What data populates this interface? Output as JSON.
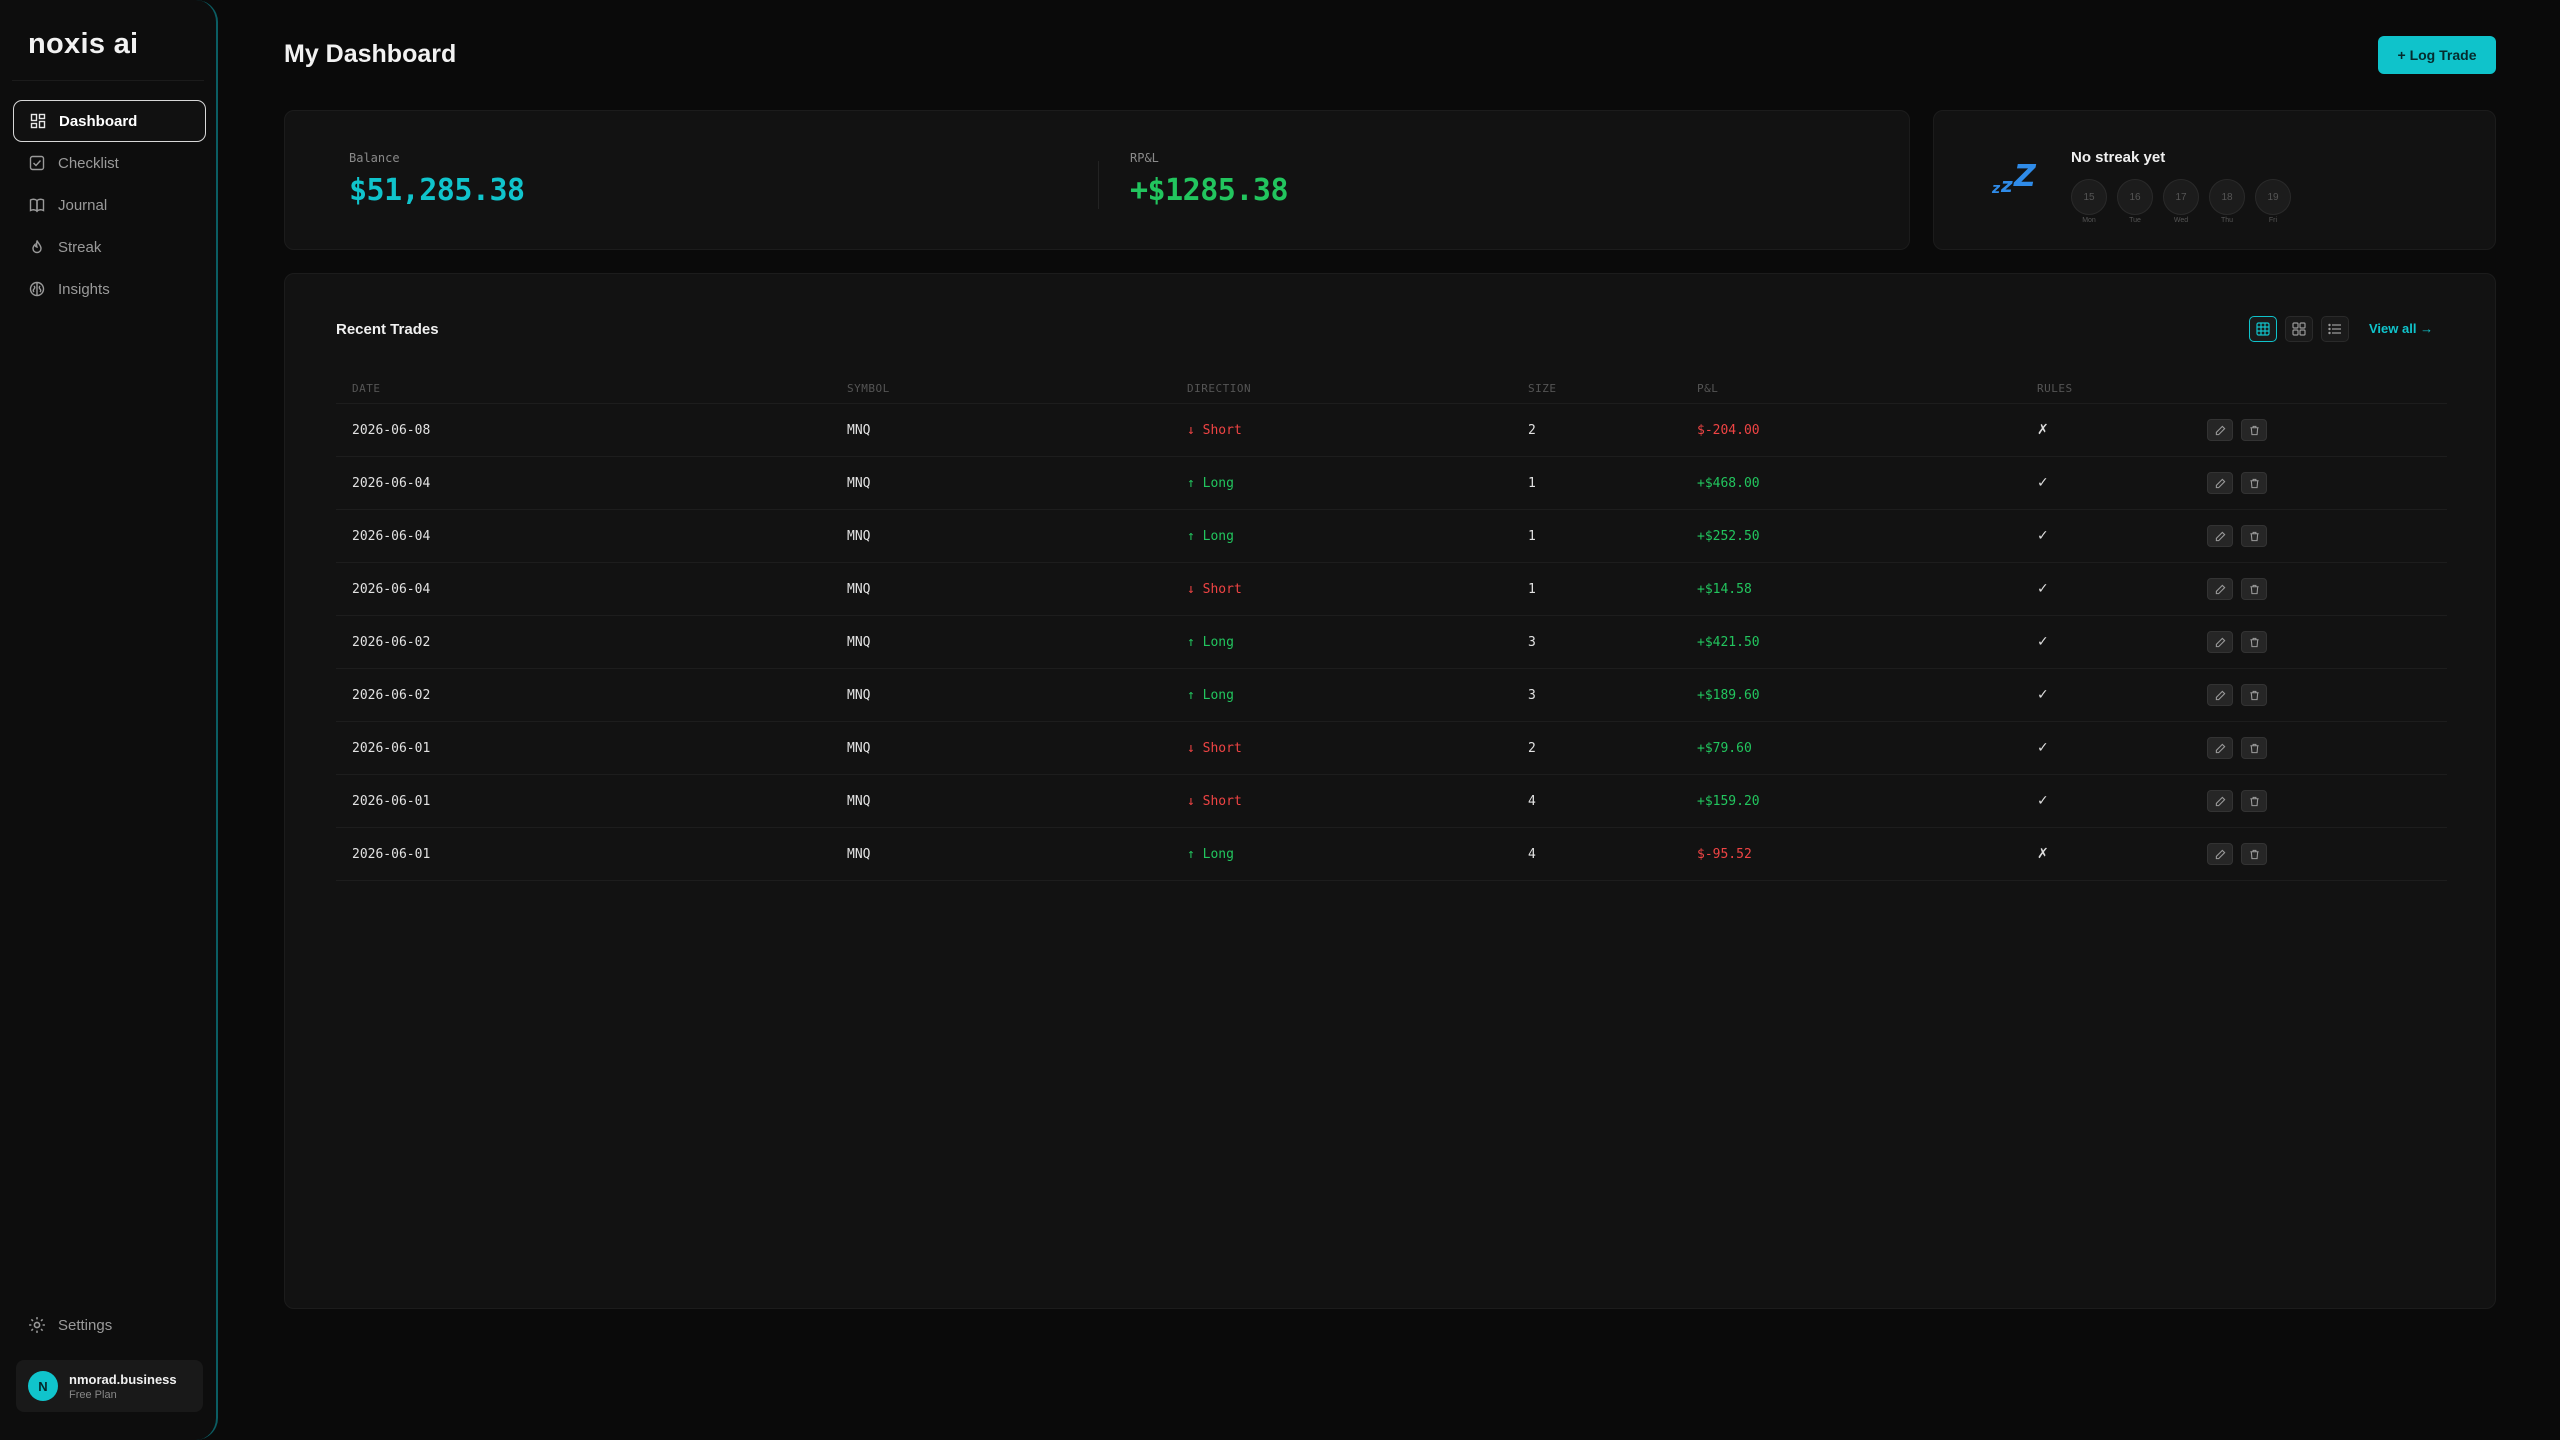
{
  "brand": "noxis ai",
  "sidebar": {
    "items": [
      {
        "label": "Dashboard",
        "icon": "dashboard-grid-icon",
        "active": true
      },
      {
        "label": "Checklist",
        "icon": "checklist-icon",
        "active": false
      },
      {
        "label": "Journal",
        "icon": "book-icon",
        "active": false
      },
      {
        "label": "Streak",
        "icon": "flame-icon",
        "active": false
      },
      {
        "label": "Insights",
        "icon": "brain-icon",
        "active": false
      }
    ],
    "settings_label": "Settings",
    "user": {
      "initial": "N",
      "name": "nmorad.business",
      "plan": "Free Plan"
    }
  },
  "header": {
    "title": "My Dashboard",
    "log_trade_label": "+ Log Trade"
  },
  "stats": {
    "balance_label": "Balance",
    "balance_value": "$51,285.38",
    "rpnl_label": "RP&L",
    "rpnl_value": "+$1285.38"
  },
  "streak": {
    "title": "No streak yet",
    "icon": "zzz-sleep-icon",
    "days": [
      {
        "num": "15",
        "label": "Mon"
      },
      {
        "num": "16",
        "label": "Tue"
      },
      {
        "num": "17",
        "label": "Wed"
      },
      {
        "num": "18",
        "label": "Thu"
      },
      {
        "num": "19",
        "label": "Fri"
      }
    ]
  },
  "trades": {
    "title": "Recent Trades",
    "view_all_label": "View all →",
    "columns": [
      "DATE",
      "SYMBOL",
      "DIRECTION",
      "SIZE",
      "P&L",
      "RULES"
    ],
    "rows": [
      {
        "date": "2026-06-08",
        "symbol": "MNQ",
        "direction": "↓ Short",
        "dir_type": "short",
        "size": "2",
        "pnl": "$-204.00",
        "pnl_type": "neg",
        "rules": "✗"
      },
      {
        "date": "2026-06-04",
        "symbol": "MNQ",
        "direction": "↑ Long",
        "dir_type": "long",
        "size": "1",
        "pnl": "+$468.00",
        "pnl_type": "pos",
        "rules": "✓"
      },
      {
        "date": "2026-06-04",
        "symbol": "MNQ",
        "direction": "↑ Long",
        "dir_type": "long",
        "size": "1",
        "pnl": "+$252.50",
        "pnl_type": "pos",
        "rules": "✓"
      },
      {
        "date": "2026-06-04",
        "symbol": "MNQ",
        "direction": "↓ Short",
        "dir_type": "short",
        "size": "1",
        "pnl": "+$14.58",
        "pnl_type": "pos",
        "rules": "✓"
      },
      {
        "date": "2026-06-02",
        "symbol": "MNQ",
        "direction": "↑ Long",
        "dir_type": "long",
        "size": "3",
        "pnl": "+$421.50",
        "pnl_type": "pos",
        "rules": "✓"
      },
      {
        "date": "2026-06-02",
        "symbol": "MNQ",
        "direction": "↑ Long",
        "dir_type": "long",
        "size": "3",
        "pnl": "+$189.60",
        "pnl_type": "pos",
        "rules": "✓"
      },
      {
        "date": "2026-06-01",
        "symbol": "MNQ",
        "direction": "↓ Short",
        "dir_type": "short",
        "size": "2",
        "pnl": "+$79.60",
        "pnl_type": "pos",
        "rules": "✓"
      },
      {
        "date": "2026-06-01",
        "symbol": "MNQ",
        "direction": "↓ Short",
        "dir_type": "short",
        "size": "4",
        "pnl": "+$159.20",
        "pnl_type": "pos",
        "rules": "✓"
      },
      {
        "date": "2026-06-01",
        "symbol": "MNQ",
        "direction": "↑ Long",
        "dir_type": "long",
        "size": "4",
        "pnl": "$-95.52",
        "pnl_type": "neg",
        "rules": "✗"
      }
    ]
  },
  "colors": {
    "accent": "#0fc3cb",
    "positive": "#22c55e",
    "negative": "#ef4444",
    "background": "#0a0a0a"
  }
}
